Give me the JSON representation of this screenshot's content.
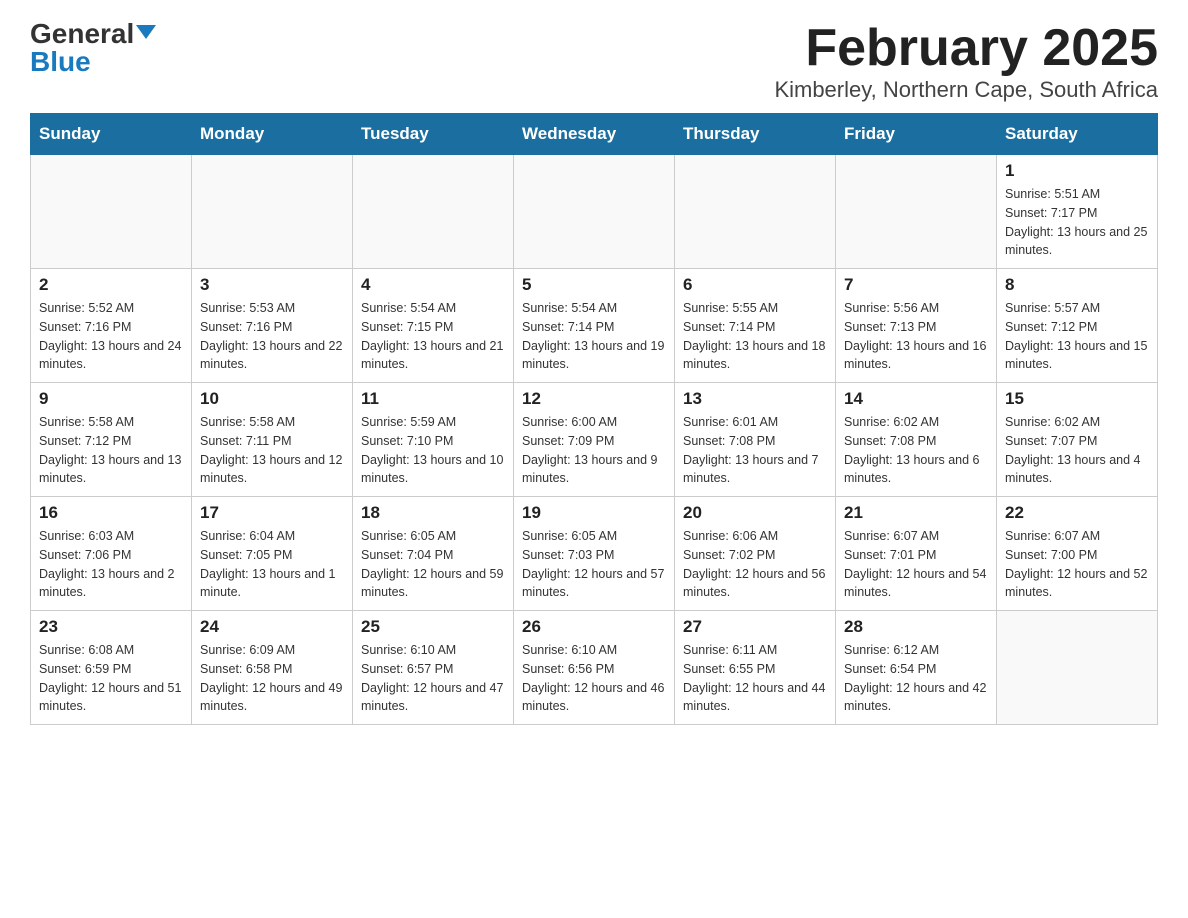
{
  "logo": {
    "general": "General",
    "blue": "Blue"
  },
  "title": "February 2025",
  "subtitle": "Kimberley, Northern Cape, South Africa",
  "weekdays": [
    "Sunday",
    "Monday",
    "Tuesday",
    "Wednesday",
    "Thursday",
    "Friday",
    "Saturday"
  ],
  "weeks": [
    [
      {
        "day": "",
        "info": ""
      },
      {
        "day": "",
        "info": ""
      },
      {
        "day": "",
        "info": ""
      },
      {
        "day": "",
        "info": ""
      },
      {
        "day": "",
        "info": ""
      },
      {
        "day": "",
        "info": ""
      },
      {
        "day": "1",
        "info": "Sunrise: 5:51 AM\nSunset: 7:17 PM\nDaylight: 13 hours and 25 minutes."
      }
    ],
    [
      {
        "day": "2",
        "info": "Sunrise: 5:52 AM\nSunset: 7:16 PM\nDaylight: 13 hours and 24 minutes."
      },
      {
        "day": "3",
        "info": "Sunrise: 5:53 AM\nSunset: 7:16 PM\nDaylight: 13 hours and 22 minutes."
      },
      {
        "day": "4",
        "info": "Sunrise: 5:54 AM\nSunset: 7:15 PM\nDaylight: 13 hours and 21 minutes."
      },
      {
        "day": "5",
        "info": "Sunrise: 5:54 AM\nSunset: 7:14 PM\nDaylight: 13 hours and 19 minutes."
      },
      {
        "day": "6",
        "info": "Sunrise: 5:55 AM\nSunset: 7:14 PM\nDaylight: 13 hours and 18 minutes."
      },
      {
        "day": "7",
        "info": "Sunrise: 5:56 AM\nSunset: 7:13 PM\nDaylight: 13 hours and 16 minutes."
      },
      {
        "day": "8",
        "info": "Sunrise: 5:57 AM\nSunset: 7:12 PM\nDaylight: 13 hours and 15 minutes."
      }
    ],
    [
      {
        "day": "9",
        "info": "Sunrise: 5:58 AM\nSunset: 7:12 PM\nDaylight: 13 hours and 13 minutes."
      },
      {
        "day": "10",
        "info": "Sunrise: 5:58 AM\nSunset: 7:11 PM\nDaylight: 13 hours and 12 minutes."
      },
      {
        "day": "11",
        "info": "Sunrise: 5:59 AM\nSunset: 7:10 PM\nDaylight: 13 hours and 10 minutes."
      },
      {
        "day": "12",
        "info": "Sunrise: 6:00 AM\nSunset: 7:09 PM\nDaylight: 13 hours and 9 minutes."
      },
      {
        "day": "13",
        "info": "Sunrise: 6:01 AM\nSunset: 7:08 PM\nDaylight: 13 hours and 7 minutes."
      },
      {
        "day": "14",
        "info": "Sunrise: 6:02 AM\nSunset: 7:08 PM\nDaylight: 13 hours and 6 minutes."
      },
      {
        "day": "15",
        "info": "Sunrise: 6:02 AM\nSunset: 7:07 PM\nDaylight: 13 hours and 4 minutes."
      }
    ],
    [
      {
        "day": "16",
        "info": "Sunrise: 6:03 AM\nSunset: 7:06 PM\nDaylight: 13 hours and 2 minutes."
      },
      {
        "day": "17",
        "info": "Sunrise: 6:04 AM\nSunset: 7:05 PM\nDaylight: 13 hours and 1 minute."
      },
      {
        "day": "18",
        "info": "Sunrise: 6:05 AM\nSunset: 7:04 PM\nDaylight: 12 hours and 59 minutes."
      },
      {
        "day": "19",
        "info": "Sunrise: 6:05 AM\nSunset: 7:03 PM\nDaylight: 12 hours and 57 minutes."
      },
      {
        "day": "20",
        "info": "Sunrise: 6:06 AM\nSunset: 7:02 PM\nDaylight: 12 hours and 56 minutes."
      },
      {
        "day": "21",
        "info": "Sunrise: 6:07 AM\nSunset: 7:01 PM\nDaylight: 12 hours and 54 minutes."
      },
      {
        "day": "22",
        "info": "Sunrise: 6:07 AM\nSunset: 7:00 PM\nDaylight: 12 hours and 52 minutes."
      }
    ],
    [
      {
        "day": "23",
        "info": "Sunrise: 6:08 AM\nSunset: 6:59 PM\nDaylight: 12 hours and 51 minutes."
      },
      {
        "day": "24",
        "info": "Sunrise: 6:09 AM\nSunset: 6:58 PM\nDaylight: 12 hours and 49 minutes."
      },
      {
        "day": "25",
        "info": "Sunrise: 6:10 AM\nSunset: 6:57 PM\nDaylight: 12 hours and 47 minutes."
      },
      {
        "day": "26",
        "info": "Sunrise: 6:10 AM\nSunset: 6:56 PM\nDaylight: 12 hours and 46 minutes."
      },
      {
        "day": "27",
        "info": "Sunrise: 6:11 AM\nSunset: 6:55 PM\nDaylight: 12 hours and 44 minutes."
      },
      {
        "day": "28",
        "info": "Sunrise: 6:12 AM\nSunset: 6:54 PM\nDaylight: 12 hours and 42 minutes."
      },
      {
        "day": "",
        "info": ""
      }
    ]
  ]
}
